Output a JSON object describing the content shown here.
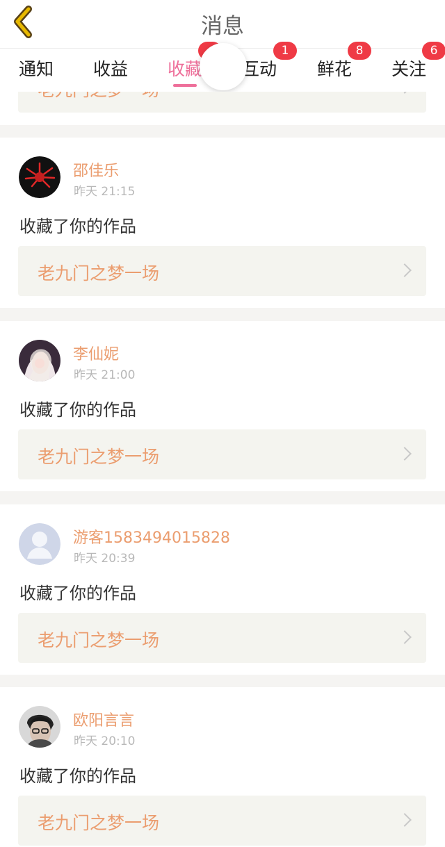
{
  "header": {
    "title": "消息",
    "back_icon": "back-chevron-icon",
    "back_color": "#e8b900"
  },
  "tabs": [
    {
      "label": "通知",
      "badge": ""
    },
    {
      "label": "收益",
      "badge": ""
    },
    {
      "label": "收藏",
      "badge": "",
      "active": true
    },
    {
      "label": "互动",
      "badge": "1"
    },
    {
      "label": "鲜花",
      "badge": "8"
    },
    {
      "label": "关注",
      "badge": "6"
    }
  ],
  "colors": {
    "accent": "#ee6f9a",
    "badge": "#ef3a45",
    "name": "#eb9d6f",
    "work_title": "#eb9d6f",
    "background": "#f5f4f2"
  },
  "partial_item": {
    "work_title": "老九门之梦一场"
  },
  "notifications": [
    {
      "username": "邵佳乐",
      "time": "昨天 21:15",
      "action": "收藏了你的作品",
      "work_title": "老九门之梦一场",
      "avatar": "red-flower-avatar"
    },
    {
      "username": "李仙妮",
      "time": "昨天 21:00",
      "action": "收藏了你的作品",
      "work_title": "老九门之梦一场",
      "avatar": "girl-photo-avatar"
    },
    {
      "username": "游客1583494015828",
      "time": "昨天 20:39",
      "action": "收藏了你的作品",
      "work_title": "老九门之梦一场",
      "avatar": "default-user-avatar"
    },
    {
      "username": "欧阳言言",
      "time": "昨天 20:10",
      "action": "收藏了你的作品",
      "work_title": "老九门之梦一场",
      "avatar": "boy-photo-avatar"
    }
  ]
}
